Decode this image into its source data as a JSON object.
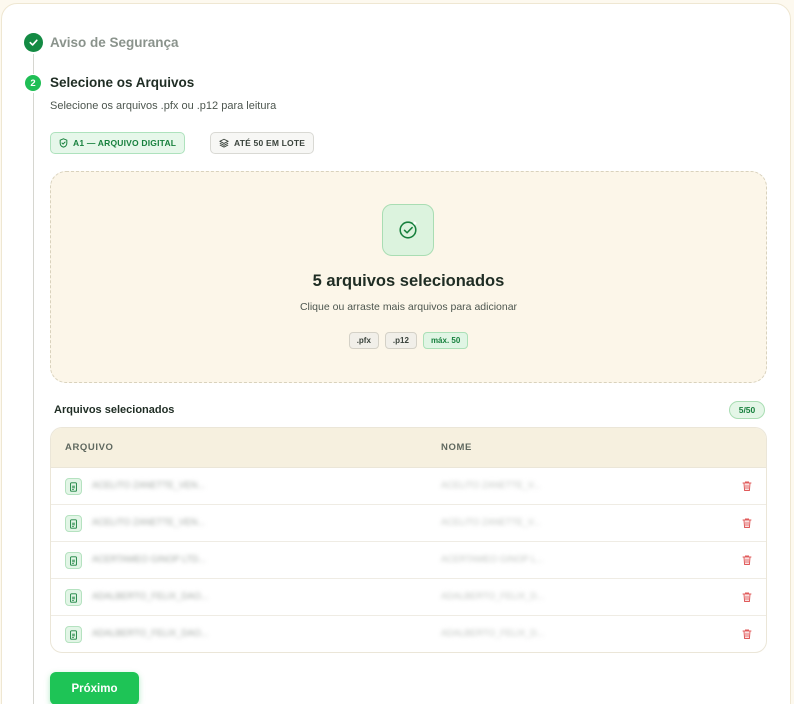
{
  "steps": {
    "step1": {
      "label": "Aviso de Segurança"
    },
    "step2": {
      "number": "2",
      "title": "Selecione os Arquivos",
      "subtitle": "Selecione os arquivos .pfx ou .p12 para leitura"
    }
  },
  "chips": {
    "a1": "A1 — ARQUIVO DIGITAL",
    "lote": "ATÉ 50 EM LOTE"
  },
  "dropzone": {
    "title": "5 arquivos selecionados",
    "subtitle": "Clique ou arraste mais arquivos para adicionar",
    "tags": [
      ".pfx",
      ".p12",
      "máx. 50"
    ]
  },
  "file_list": {
    "title": "Arquivos selecionados",
    "count": "5/50",
    "columns": [
      "ARQUIVO",
      "NOME"
    ],
    "rows": [
      {
        "file": "ACELITO ZANETTE_VEN...",
        "name": "ACELITO ZANETTE_V..."
      },
      {
        "file": "ACELITO ZANETTE_VEN...",
        "name": "ACELITO ZANETTE_V..."
      },
      {
        "file": "ACERTAMEO GINOP LTD...",
        "name": "ACERTAMEO GINOP L..."
      },
      {
        "file": "ADALBERTO_FELIX_DAO...",
        "name": "ADALBERTO_FELIX_D..."
      },
      {
        "file": "ADALBERTO_FELIX_DAO...",
        "name": "ADALBERTO_FELIX_D..."
      }
    ]
  },
  "actions": {
    "next": "Próximo"
  },
  "colors": {
    "primary": "#1ec456",
    "dark_green": "#138a43",
    "danger": "#e05a5a",
    "background": "#fdf9ef"
  },
  "icons": {
    "step_done": "check-circle-icon",
    "dropzone": "check-circle-outline-icon",
    "row_file": "file-icon",
    "row_action": "trash-icon"
  }
}
